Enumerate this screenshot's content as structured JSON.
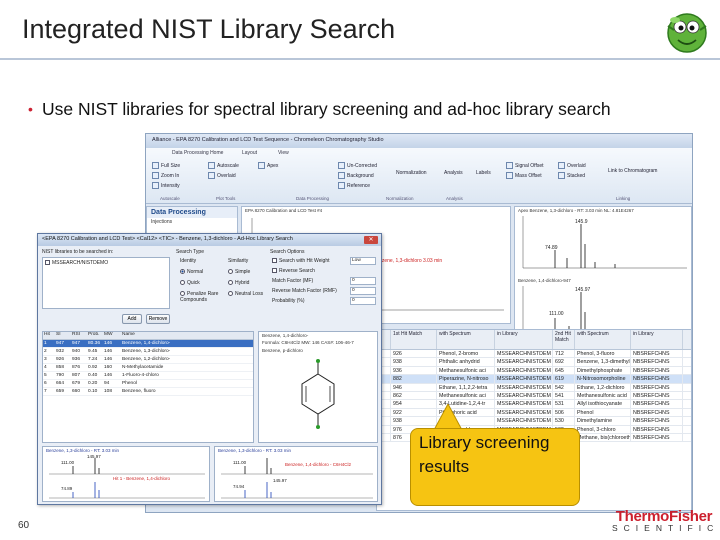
{
  "slide": {
    "title": "Integrated NIST Library Search",
    "bullet": "Use NIST libraries for spectral library screening and ad-hoc library search",
    "page_number": "60",
    "brand_top": "ThermoFisher",
    "brand_bottom": "SCIENTIFIC",
    "callout": "Library screening results"
  },
  "back_window": {
    "title": "Alliance - EPA 8270 Calibration and LCD Test Sequence - Chromeleon Chromatography Studio",
    "ribbon_tabs": [
      "Data Processing Home",
      "Layout",
      "View"
    ],
    "ribbon_buttons": [
      "Full Size",
      "Zoom In",
      "Intensity",
      "Autoscale",
      "Overlaid",
      "Apex",
      "Un-Corrected",
      "Background",
      "Reference",
      "Normalization",
      "Analysis",
      "Labels",
      "Signal Offset",
      "Mass Offset",
      "Overlaid",
      "Stacked",
      "Link to Chromatogram"
    ],
    "ribbon_groups": [
      "Autoscale",
      "Plot Tools",
      "Data Processing",
      "Normalization",
      "Analysis",
      "Linking"
    ],
    "data_processing_title": "Data Processing",
    "data_processing_items": [
      "Injections"
    ],
    "spectrum_header": "EPA 8270 Calibration and LCD Test #4",
    "top_spectrum_header": "Apex Benzene, 1,3-dichloro - RT: 3.03 min  NL: 4.81E4267",
    "lower_spectrum_header": "Benzene, 1,4-dichloro-947",
    "peak_labels": [
      "145.9",
      "74.89",
      "111.00",
      "145.97"
    ],
    "chromatogram_label": "21 Benzene, 1,3-dichloro 3.03 min",
    "grid_headers": [
      "1st Hit Match",
      "with Spectrum",
      "in Library",
      "2nd Hit Match",
      "with Spectrum",
      "in Library"
    ],
    "grid_rows": [
      [
        "926",
        "Phenol, 2-bromo",
        "MSSEARCHNISTDEM",
        "712",
        "Phenol, 3-fluoro",
        "NBSREFCHNS"
      ],
      [
        "938",
        "Phthalic anhydrid",
        "MSSEARCHNISTDEM",
        "692",
        "Benzene, 1,3-dimethyl",
        "NBSREFCHNS"
      ],
      [
        "936",
        "Methanesulfonic aci",
        "MSSEARCHNISTDEM",
        "645",
        "Dimethylphosphate",
        "NBSREFCHNS"
      ],
      [
        "882",
        "Piperazine, N-nitroso",
        "MSSEARCHNISTDEM",
        "619",
        "N-Nitrosomorpholine",
        "NBSREFCHNS"
      ],
      [
        "946",
        "Ethane, 1,1,2,2-tetra",
        "MSSEARCHNISTDEM",
        "542",
        "Ethane, 1,2-dichloro",
        "NBSREFCHNS"
      ],
      [
        "862",
        "Methanesulfonic aci",
        "MSSEARCHNISTDEM",
        "541",
        "Methanesulfonic acid",
        "NBSREFCHNS"
      ],
      [
        "954",
        "3,4-Lutidine-1,2,4-tr",
        "MSSEARCHNISTDEM",
        "531",
        "Allyl isothiocyanate",
        "NBSREFCHNS"
      ],
      [
        "922",
        "Phosphoric acid",
        "MSSEARCHNISTDEM",
        "506",
        "Phenol",
        "NBSREFCHNS"
      ],
      [
        "938",
        "Aniline",
        "MSSEARCHNISTDEM",
        "530",
        "Dimethylamine",
        "NBSREFCHNS"
      ],
      [
        "976",
        "Phenol, 2-chloro",
        "MSSEARCHNISTDEM",
        "532",
        "Phenol, 3-chloro",
        "NBSREFCHNS"
      ],
      [
        "876",
        "1,4-dichloro-2-methyl",
        "MSSEARCHNISTDEM",
        "553",
        "Methane, bis(chloroethoxy)",
        "NBSREFCHNS"
      ]
    ]
  },
  "dialog": {
    "title": "<EPA 8270 Calibration and LCD Test> <Cal12> <TIC> - Benzene, 1,3-dichloro - Ad-Hoc Library Search",
    "libraries_label": "NIST libraries to be searched in:",
    "library_item": "MSSEARCH/NISTDEMO",
    "search_type_label": "Search Type",
    "search_type_cols": [
      "Identity",
      "Similarity"
    ],
    "search_types": [
      "Normal",
      "Quick",
      "Penalize Rare Compounds",
      "Simple",
      "Hybrid",
      "Neutral Loss"
    ],
    "search_options_label": "Search Options",
    "search_options": [
      "Search with Hit Weight",
      "Reverse Search",
      "Match Factor (MF)",
      "Reverse Match Factor (RMF)",
      "Probability (%)"
    ],
    "option_values": [
      "Low",
      "0",
      "0",
      "0"
    ],
    "add_button": "Add",
    "remove_button": "Remove",
    "result_headers": [
      "Hit",
      "SI",
      "RSI",
      "Prob.",
      "MW",
      "Name"
    ],
    "results": [
      [
        "1",
        "947",
        "947",
        "80.36",
        "146",
        "Benzene, 1,4-dichloro-"
      ],
      [
        "2",
        "932",
        "940",
        "9.45",
        "146",
        "Benzene, 1,3-dichloro-"
      ],
      [
        "3",
        "926",
        "936",
        "7.24",
        "146",
        "Benzene, 1,2-dichloro-"
      ],
      [
        "4",
        "858",
        "876",
        "0.92",
        "160",
        "N-Methylacetamide"
      ],
      [
        "5",
        "790",
        "807",
        "0.40",
        "146",
        "1-Fluoro-4-chloro"
      ],
      [
        "6",
        "664",
        "679",
        "0.20",
        "94",
        "Phenol"
      ],
      [
        "7",
        "659",
        "660",
        "0.10",
        "108",
        "Benzene, fluoro"
      ]
    ],
    "structure_caption": [
      "Benzene, 1,4-dichloro-",
      "Formula: C6H4Cl2  MW: 146  CAS#: 106-46-7",
      "Benzene, p-dichloro"
    ],
    "mini_spec_headers": [
      "Benzene, 1,3-dichloro - RT: 3.03 min",
      "Benzene, 1,3-dichloro - RT: 3.03 min"
    ],
    "mini_spec_sub": [
      "Hit 1 - Benzene, 1,4-dichloro",
      "Benzene, 1,4-dichloro - C6H4Cl2"
    ],
    "mini_spec_peaks": [
      "111.00",
      "145.97",
      "74.89",
      "111.00",
      "74.94",
      "145.97"
    ]
  }
}
